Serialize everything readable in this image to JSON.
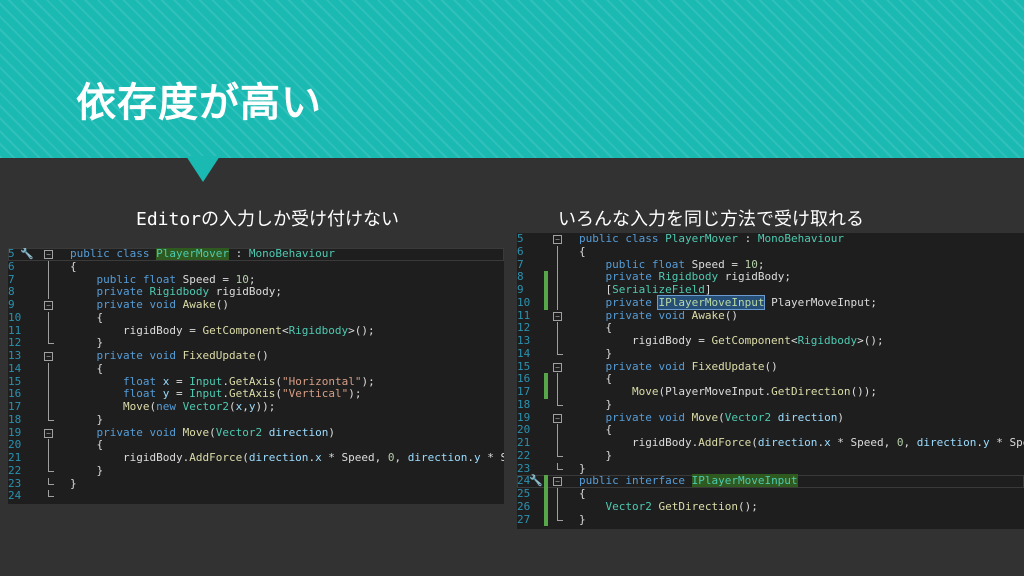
{
  "slide": {
    "title": "依存度が高い",
    "caption_left": "Editorの入力しか受け付けない",
    "caption_right": "いろんな入力を同じ方法で受け取れる"
  },
  "colors": {
    "header": "#1ab9b2",
    "background": "#323232",
    "editor_bg": "#1e1e1e"
  },
  "left_code": {
    "line_numbers": [
      "5",
      "6",
      "7",
      "8",
      "9",
      "10",
      "11",
      "12",
      "13",
      "14",
      "15",
      "16",
      "17",
      "18",
      "19",
      "20",
      "21",
      "22",
      "23",
      "24"
    ]
  },
  "right_code": {
    "line_numbers": [
      "5",
      "6",
      "7",
      "8",
      "9",
      "10",
      "11",
      "12",
      "13",
      "14",
      "15",
      "16",
      "17",
      "18",
      "19",
      "20",
      "21",
      "22",
      "23",
      "24",
      "25",
      "26",
      "27"
    ]
  }
}
